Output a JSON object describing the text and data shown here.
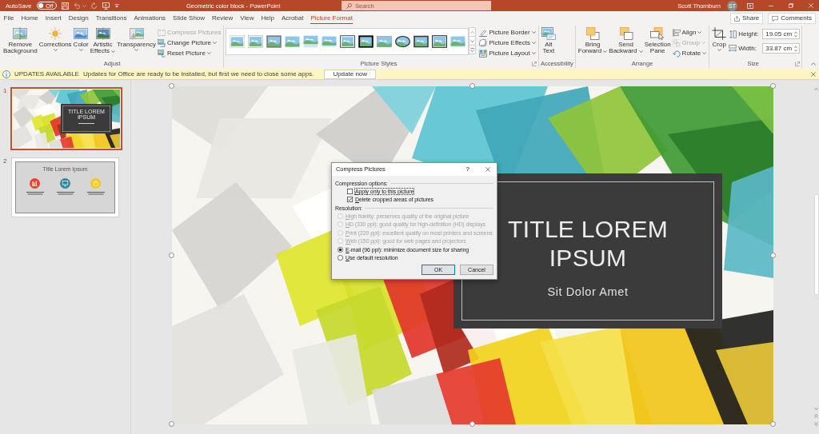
{
  "title_bar": {
    "autosave": {
      "label": "AutoSave",
      "state": "Off",
      "on": false
    },
    "document_title": "Geometric color block - PowerPoint",
    "search": {
      "placeholder": "Search"
    },
    "user_name": "Scott Thornburn",
    "user_initials": "ST"
  },
  "menu": {
    "tabs": [
      {
        "label": "File",
        "selected": false
      },
      {
        "label": "Home",
        "selected": false
      },
      {
        "label": "Insert",
        "selected": false
      },
      {
        "label": "Design",
        "selected": false
      },
      {
        "label": "Transitions",
        "selected": false
      },
      {
        "label": "Animations",
        "selected": false
      },
      {
        "label": "Slide Show",
        "selected": false
      },
      {
        "label": "Review",
        "selected": false
      },
      {
        "label": "View",
        "selected": false
      },
      {
        "label": "Help",
        "selected": false
      },
      {
        "label": "Acrobat",
        "selected": false
      },
      {
        "label": "Picture Format",
        "selected": true
      }
    ],
    "share": "Share",
    "comments": "Comments"
  },
  "ribbon": [
    {
      "label": "Adjust",
      "launcher": false,
      "items": [
        {
          "kind": "large",
          "label": "Remove Background",
          "dropdown": false
        },
        {
          "kind": "large",
          "label": "Corrections",
          "dropdown": true
        },
        {
          "kind": "large",
          "label": "Color",
          "dropdown": true
        },
        {
          "kind": "large",
          "label": "Artistic Effects",
          "dropdown": true
        },
        {
          "kind": "large",
          "label": "Transparency",
          "dropdown": true
        },
        {
          "kind": "stack",
          "buttons": [
            {
              "label": "Compress Pictures",
              "dropdown": false,
              "disabled": true
            },
            {
              "label": "Change Picture",
              "dropdown": true,
              "disabled": false
            },
            {
              "label": "Reset Picture",
              "dropdown": true,
              "disabled": false
            }
          ]
        }
      ]
    },
    {
      "label": "Picture Styles",
      "launcher": true,
      "items": [
        {
          "kind": "gallery"
        },
        {
          "kind": "stack",
          "buttons": [
            {
              "label": "Picture Border",
              "dropdown": true,
              "disabled": false
            },
            {
              "label": "Picture Effects",
              "dropdown": true,
              "disabled": false
            },
            {
              "label": "Picture Layout",
              "dropdown": true,
              "disabled": false
            }
          ]
        }
      ]
    },
    {
      "label": "Accessibility",
      "launcher": false,
      "items": [
        {
          "kind": "large",
          "label": "Alt Text",
          "dropdown": false
        }
      ]
    },
    {
      "label": "Arrange",
      "launcher": false,
      "items": [
        {
          "kind": "large",
          "label": "Bring Forward",
          "dropdown": true
        },
        {
          "kind": "large",
          "label": "Send Backward",
          "dropdown": true
        },
        {
          "kind": "large",
          "label": "Selection Pane",
          "dropdown": false
        },
        {
          "kind": "stack",
          "buttons": [
            {
              "label": "Align",
              "dropdown": true,
              "disabled": false
            },
            {
              "label": "Group",
              "dropdown": true,
              "disabled": true
            },
            {
              "label": "Rotate",
              "dropdown": true,
              "disabled": false
            }
          ]
        }
      ]
    },
    {
      "label": "Size",
      "launcher": true,
      "items": [
        {
          "kind": "large",
          "label": "Crop",
          "dropdown": true
        },
        {
          "kind": "fields",
          "fields": [
            {
              "label": "Height:",
              "value": "19.05 cm"
            },
            {
              "label": "Width:",
              "value": "33.87 cm"
            }
          ]
        }
      ]
    }
  ],
  "update_bar": {
    "title": "UPDATES AVAILABLE",
    "message": "Updates for Office are ready to be installed, but first we need to close some apps.",
    "button": "Update now"
  },
  "thumbnails": [
    {
      "number": "1",
      "selected": true,
      "kind": "title_slide",
      "title": "TITLE LOREM IPSUM"
    },
    {
      "number": "2",
      "selected": false,
      "kind": "icon_slide",
      "title": "Title Lorem Ipsum",
      "icons": [
        {
          "color": "#e8442d"
        },
        {
          "color": "#2b8a9c"
        },
        {
          "color": "#f5c820"
        }
      ]
    }
  ],
  "slide": {
    "title": "TITLE LOREM IPSUM",
    "subtitle": "Sit Dolor Amet"
  },
  "dialog": {
    "title": "Compress Pictures",
    "help": "?",
    "compression_label": "Compression options:",
    "options": [
      {
        "label": "Apply only to this picture",
        "checked": false,
        "focused": true
      },
      {
        "label": "Delete cropped areas of pictures",
        "checked": true,
        "focused": false
      }
    ],
    "resolution_label": "Resolution:",
    "resolutions": [
      {
        "label": "High fidelity: preserves quality of the original picture",
        "selected": false,
        "disabled": true
      },
      {
        "label": "HD (330 ppi): good quality for high-definition (HD) displays",
        "selected": false,
        "disabled": true
      },
      {
        "label": "Print (220 ppi): excellent quality on most printers and screens",
        "selected": false,
        "disabled": true
      },
      {
        "label": "Web (150 ppi): good for web pages and projectors",
        "selected": false,
        "disabled": true
      },
      {
        "label": "E-mail (96 ppi): minimize document size for sharing",
        "selected": true,
        "disabled": false
      },
      {
        "label": "Use default resolution",
        "selected": false,
        "disabled": false
      }
    ],
    "buttons": [
      {
        "label": "OK",
        "default": true
      },
      {
        "label": "Cancel",
        "default": false
      }
    ]
  }
}
